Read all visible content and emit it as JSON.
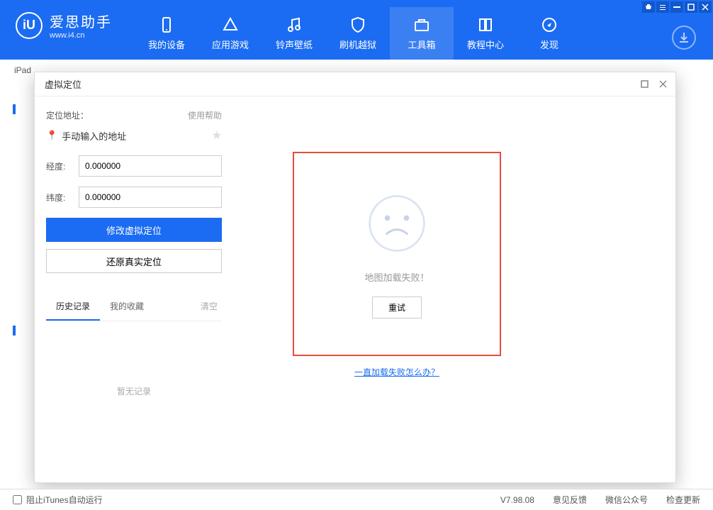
{
  "titlebar": {
    "icons": [
      "shop",
      "list",
      "min",
      "max",
      "close"
    ]
  },
  "brand": {
    "title": "爱思助手",
    "subtitle": "www.i4.cn",
    "logo": "iU"
  },
  "nav": [
    {
      "name": "my-device",
      "label": "我的设备"
    },
    {
      "name": "apps",
      "label": "应用游戏"
    },
    {
      "name": "ringtones",
      "label": "铃声壁纸"
    },
    {
      "name": "flash",
      "label": "刷机越狱"
    },
    {
      "name": "toolbox",
      "label": "工具箱",
      "active": true
    },
    {
      "name": "tutorials",
      "label": "教程中心"
    },
    {
      "name": "discover",
      "label": "发现"
    }
  ],
  "device_bar": "iPad",
  "modal": {
    "title": "虚拟定位",
    "address_label": "定位地址：",
    "help": "使用帮助",
    "manual_input": "手动输入的地址",
    "longitude_label": "经度:",
    "longitude_value": "0.000000",
    "latitude_label": "纬度:",
    "latitude_value": "0.000000",
    "modify_btn": "修改虚拟定位",
    "restore_btn": "还原真实定位",
    "tab_history": "历史记录",
    "tab_favorites": "我的收藏",
    "tab_clear": "清空",
    "empty_history": "暂无记录",
    "map_fail": "地图加载失败！",
    "retry": "重试",
    "fail_help": "一直加载失败怎么办？"
  },
  "footer": {
    "block_itunes": "阻止iTunes自动运行",
    "version": "V7.98.08",
    "feedback": "意见反馈",
    "wechat": "微信公众号",
    "update": "检查更新"
  }
}
